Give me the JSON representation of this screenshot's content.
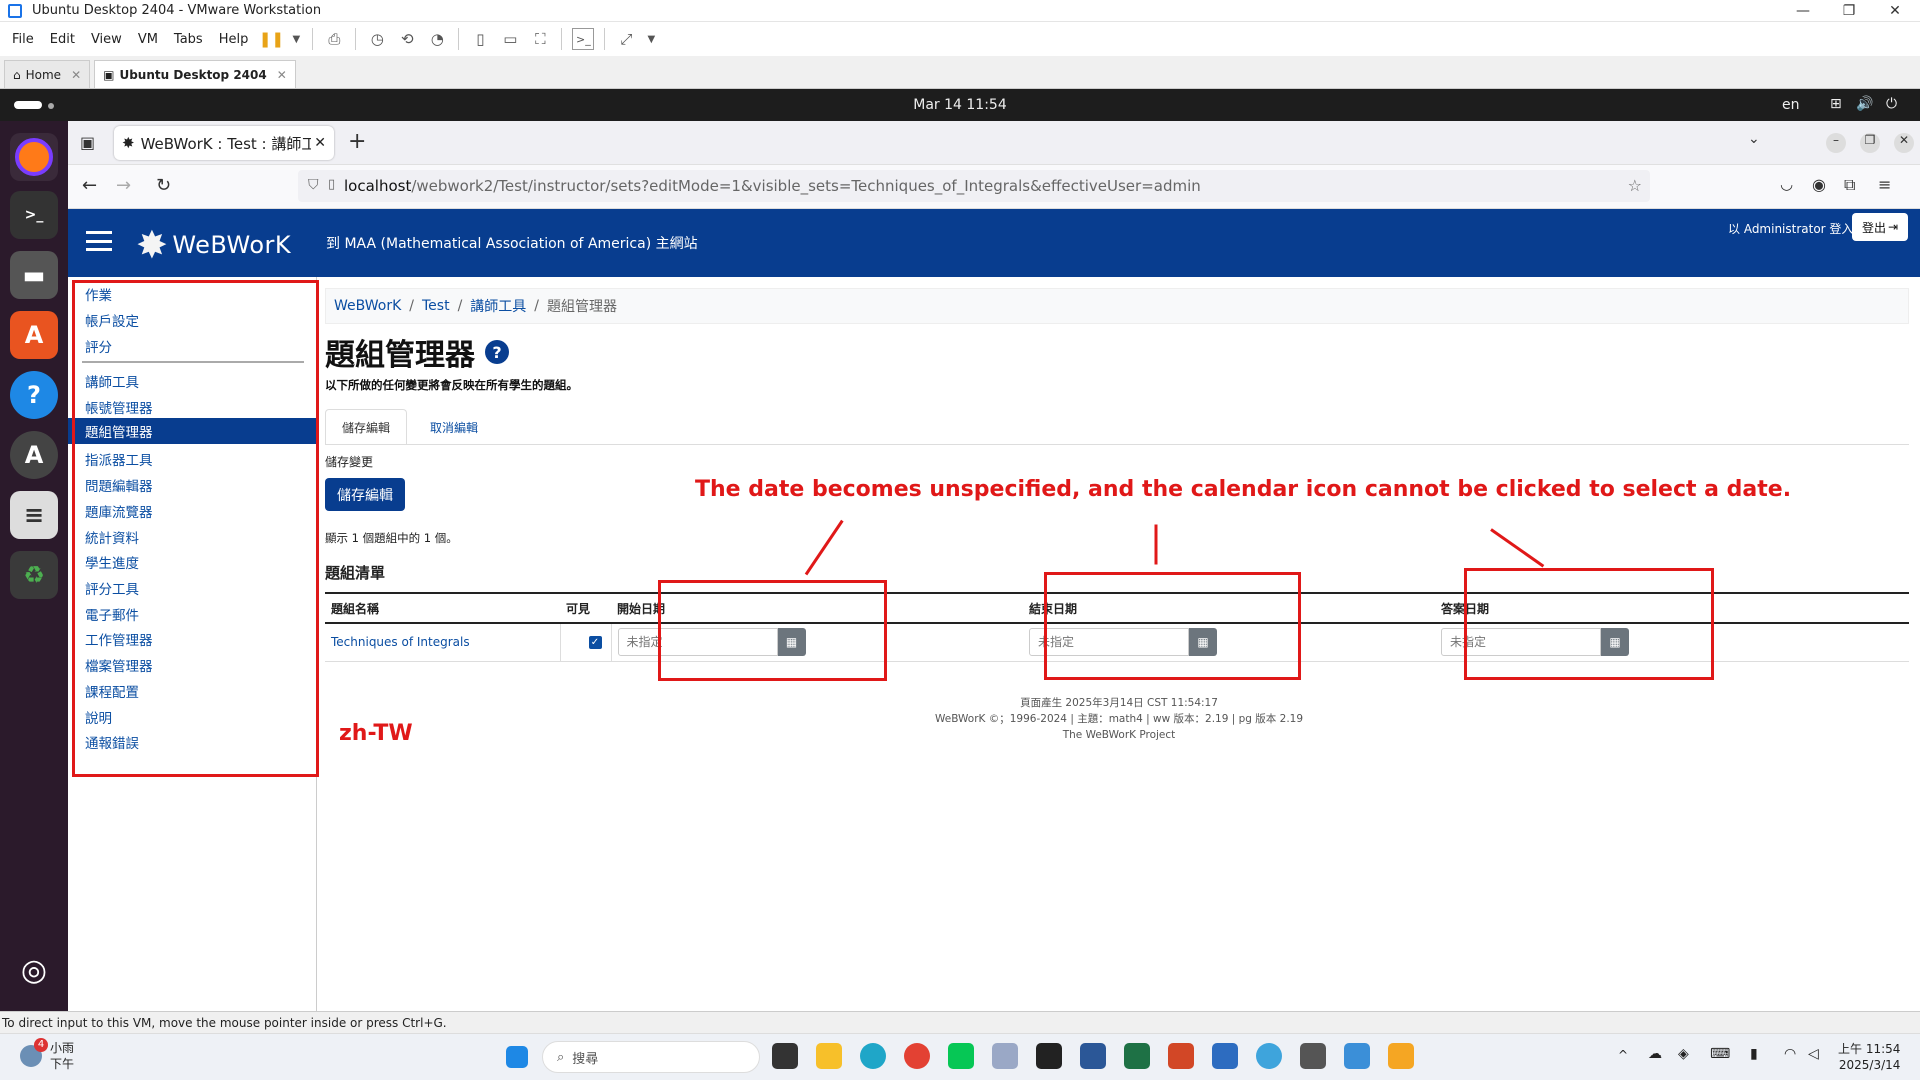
{
  "vmware": {
    "window_title": "Ubuntu Desktop 2404 - VMware Workstation",
    "menu": [
      "File",
      "Edit",
      "View",
      "VM",
      "Tabs",
      "Help"
    ],
    "tabs": [
      {
        "label": "Home"
      },
      {
        "label": "Ubuntu Desktop 2404"
      }
    ],
    "status_text": "To direct input to this VM, move the mouse pointer inside or press Ctrl+G."
  },
  "ubuntu": {
    "clock": "Mar 14  11:54",
    "lang": "en"
  },
  "firefox": {
    "tab_title": "WeBWorK : Test : 講師工具",
    "new_tab": "+",
    "url_host": "localhost",
    "url_path": "/webwork2/Test/instructor/sets?editMode=1&visible_sets=Techniques_of_Integrals&effectiveUser=admin"
  },
  "header": {
    "logo_text": "WeBWorK",
    "maa_link": "到 MAA (Mathematical Association of America) 主網站",
    "logged_in": "以 Administrator 登入。",
    "logout": "登出"
  },
  "sidebar": {
    "items_top": [
      "作業",
      "帳戶設定",
      "評分"
    ],
    "items_instructor": [
      "講師工具",
      "帳號管理器",
      "題組管理器",
      "指派器工具",
      "問題編輯器",
      "題庫流覽器",
      "統計資料",
      "學生進度",
      "評分工具",
      "電子郵件",
      "工作管理器",
      "檔案管理器",
      "課程配置",
      "說明",
      "通報錯誤"
    ],
    "active_index": 2
  },
  "breadcrumb": {
    "items": [
      "WeBWorK",
      "Test",
      "講師工具"
    ],
    "current": "題組管理器"
  },
  "page": {
    "title": "題組管理器",
    "help": "?",
    "subtitle": "以下所做的任何變更將會反映在所有學生的題組。",
    "tab_save": "儲存編輯",
    "tab_cancel": "取消編輯",
    "save_label": "儲存變更",
    "save_button": "儲存編輯",
    "showing": "顯示 1 個題組中的 1 個。",
    "set_list_heading": "題組清單"
  },
  "table": {
    "headers": [
      "題組名稱",
      "可見",
      "開始日期",
      "結束日期",
      "答案日期"
    ],
    "rows": [
      {
        "set_name": "Techniques of Integrals",
        "visible": true,
        "open": "未指定",
        "due": "未指定",
        "answer": "未指定"
      }
    ]
  },
  "footer": {
    "line1": "頁面產生 2025年3月14日 CST 11:54:17",
    "line2": "WeBWorK ©；1996-2024 | 主題：math4 | ww 版本：2.19 | pg 版本 2.19",
    "line3": "The WeBWorK Project"
  },
  "annotations": {
    "main_note": "The date becomes unspecified, and the calendar icon cannot be clicked to select a date.",
    "locale_note": "zh-TW",
    "color": "#e01818"
  },
  "taskbar": {
    "weather_badge": "4",
    "weather_line1": "小雨",
    "weather_line2": "下午",
    "search_placeholder": "搜尋",
    "time": "上午 11:54",
    "date": "2025/3/14"
  },
  "colors": {
    "webwork_blue": "#083d8f",
    "link_blue": "#0b4ea2"
  }
}
